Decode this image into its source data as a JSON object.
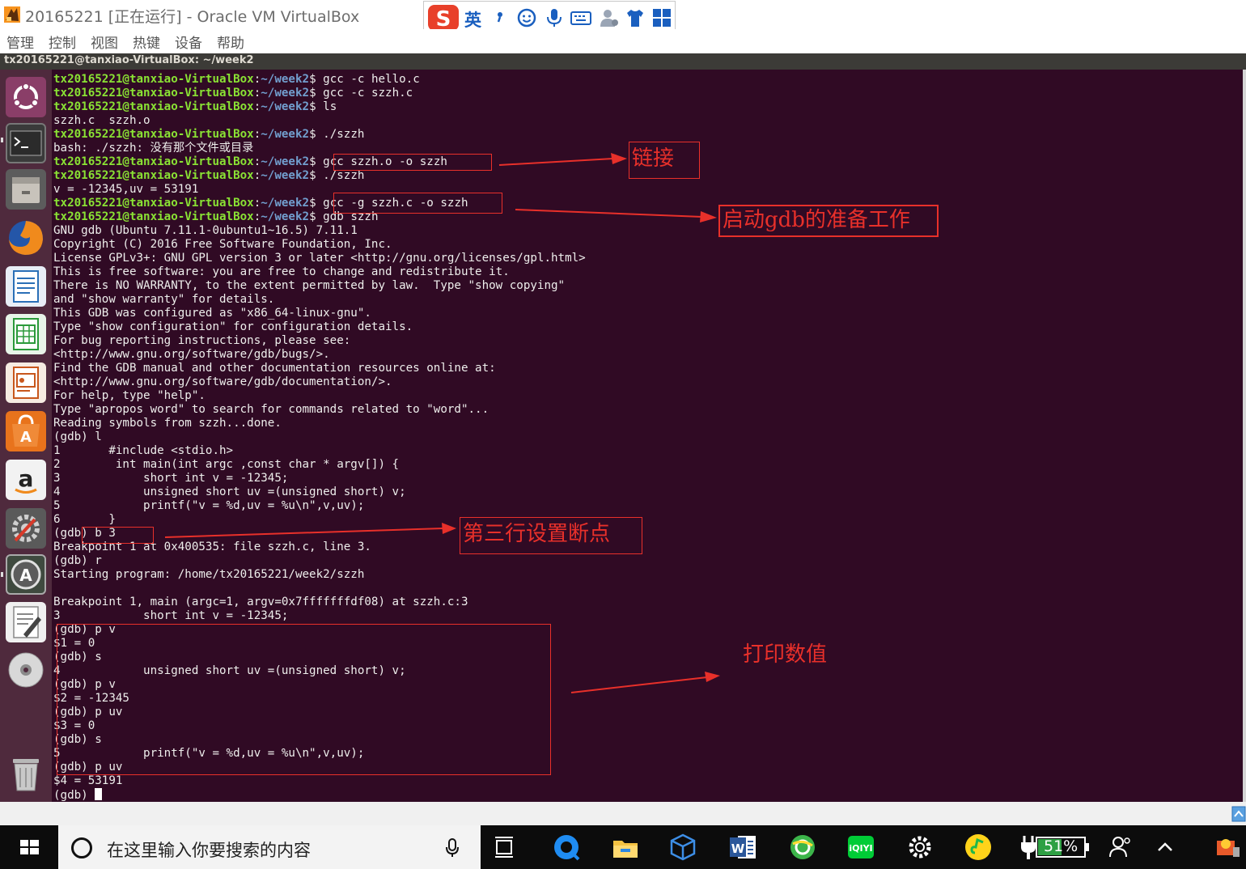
{
  "window": {
    "title": "20165221 [正在运行] - Oracle VM VirtualBox",
    "ime_lang": "英",
    "menu": [
      "管理",
      "控制",
      "视图",
      "热键",
      "设备",
      "帮助"
    ]
  },
  "terminal": {
    "title": "tx20165221@tanxiao-VirtualBox: ~/week2",
    "prompt_user": "tx20165221@tanxiao-VirtualBox",
    "prompt_path": "~/week2",
    "lines": [
      {
        "prompt": true,
        "cmd": "gcc -c hello.c"
      },
      {
        "prompt": true,
        "cmd": "gcc -c szzh.c"
      },
      {
        "prompt": true,
        "cmd": "ls"
      },
      {
        "text": "szzh.c  szzh.o"
      },
      {
        "prompt": true,
        "cmd": "./szzh"
      },
      {
        "text": "bash: ./szzh: 没有那个文件或目录"
      },
      {
        "prompt": true,
        "cmd": "gcc szzh.o -o szzh"
      },
      {
        "prompt": true,
        "cmd": "./szzh"
      },
      {
        "text": "v = -12345,uv = 53191"
      },
      {
        "prompt": true,
        "cmd": "gcc -g szzh.c -o szzh"
      },
      {
        "prompt": true,
        "cmd": "gdb szzh"
      },
      {
        "text": "GNU gdb (Ubuntu 7.11.1-0ubuntu1~16.5) 7.11.1"
      },
      {
        "text": "Copyright (C) 2016 Free Software Foundation, Inc."
      },
      {
        "text": "License GPLv3+: GNU GPL version 3 or later <http://gnu.org/licenses/gpl.html>"
      },
      {
        "text": "This is free software: you are free to change and redistribute it."
      },
      {
        "text": "There is NO WARRANTY, to the extent permitted by law.  Type \"show copying\""
      },
      {
        "text": "and \"show warranty\" for details."
      },
      {
        "text": "This GDB was configured as \"x86_64-linux-gnu\"."
      },
      {
        "text": "Type \"show configuration\" for configuration details."
      },
      {
        "text": "For bug reporting instructions, please see:"
      },
      {
        "text": "<http://www.gnu.org/software/gdb/bugs/>."
      },
      {
        "text": "Find the GDB manual and other documentation resources online at:"
      },
      {
        "text": "<http://www.gnu.org/software/gdb/documentation/>."
      },
      {
        "text": "For help, type \"help\"."
      },
      {
        "text": "Type \"apropos word\" to search for commands related to \"word\"..."
      },
      {
        "text": "Reading symbols from szzh...done."
      },
      {
        "text": "(gdb) l"
      },
      {
        "text": "1\t#include <stdio.h>"
      },
      {
        "text": "2\t int main(int argc ,const char * argv[]) {"
      },
      {
        "text": "3\t     short int v = -12345;"
      },
      {
        "text": "4\t     unsigned short uv =(unsigned short) v;"
      },
      {
        "text": "5\t     printf(\"v = %d,uv = %u\\n\",v,uv);"
      },
      {
        "text": "6\t}"
      },
      {
        "text": "(gdb) b 3"
      },
      {
        "text": "Breakpoint 1 at 0x400535: file szzh.c, line 3."
      },
      {
        "text": "(gdb) r"
      },
      {
        "text": "Starting program: /home/tx20165221/week2/szzh "
      },
      {
        "text": ""
      },
      {
        "text": "Breakpoint 1, main (argc=1, argv=0x7fffffffdf08) at szzh.c:3"
      },
      {
        "text": "3\t     short int v = -12345;"
      },
      {
        "text": "(gdb) p v"
      },
      {
        "text": "$1 = 0"
      },
      {
        "text": "(gdb) s"
      },
      {
        "text": "4\t     unsigned short uv =(unsigned short) v;"
      },
      {
        "text": "(gdb) p v"
      },
      {
        "text": "$2 = -12345"
      },
      {
        "text": "(gdb) p uv"
      },
      {
        "text": "$3 = 0"
      },
      {
        "text": "(gdb) s"
      },
      {
        "text": "5\t     printf(\"v = %d,uv = %u\\n\",v,uv);"
      },
      {
        "text": "(gdb) p uv"
      },
      {
        "text": "$4 = 53191"
      },
      {
        "text": "(gdb) ",
        "cursor": true
      }
    ]
  },
  "annotations": {
    "link": "链接",
    "gdb_prep": "启动gdb的准备工作",
    "breakpoint": "第三行设置断点",
    "print": "打印数值",
    "color": "#e8302a"
  },
  "launcher_icons": [
    "ubuntu-dash-icon",
    "terminal-icon",
    "files-icon",
    "firefox-icon",
    "writer-icon",
    "calc-icon",
    "impress-icon",
    "software-center-icon",
    "amazon-icon",
    "system-settings-icon",
    "software-updater-icon",
    "text-editor-icon",
    "dvd-icon",
    "trash-icon"
  ],
  "taskbar": {
    "search_placeholder": "在这里输入你要搜索的内容",
    "battery": "51%"
  }
}
